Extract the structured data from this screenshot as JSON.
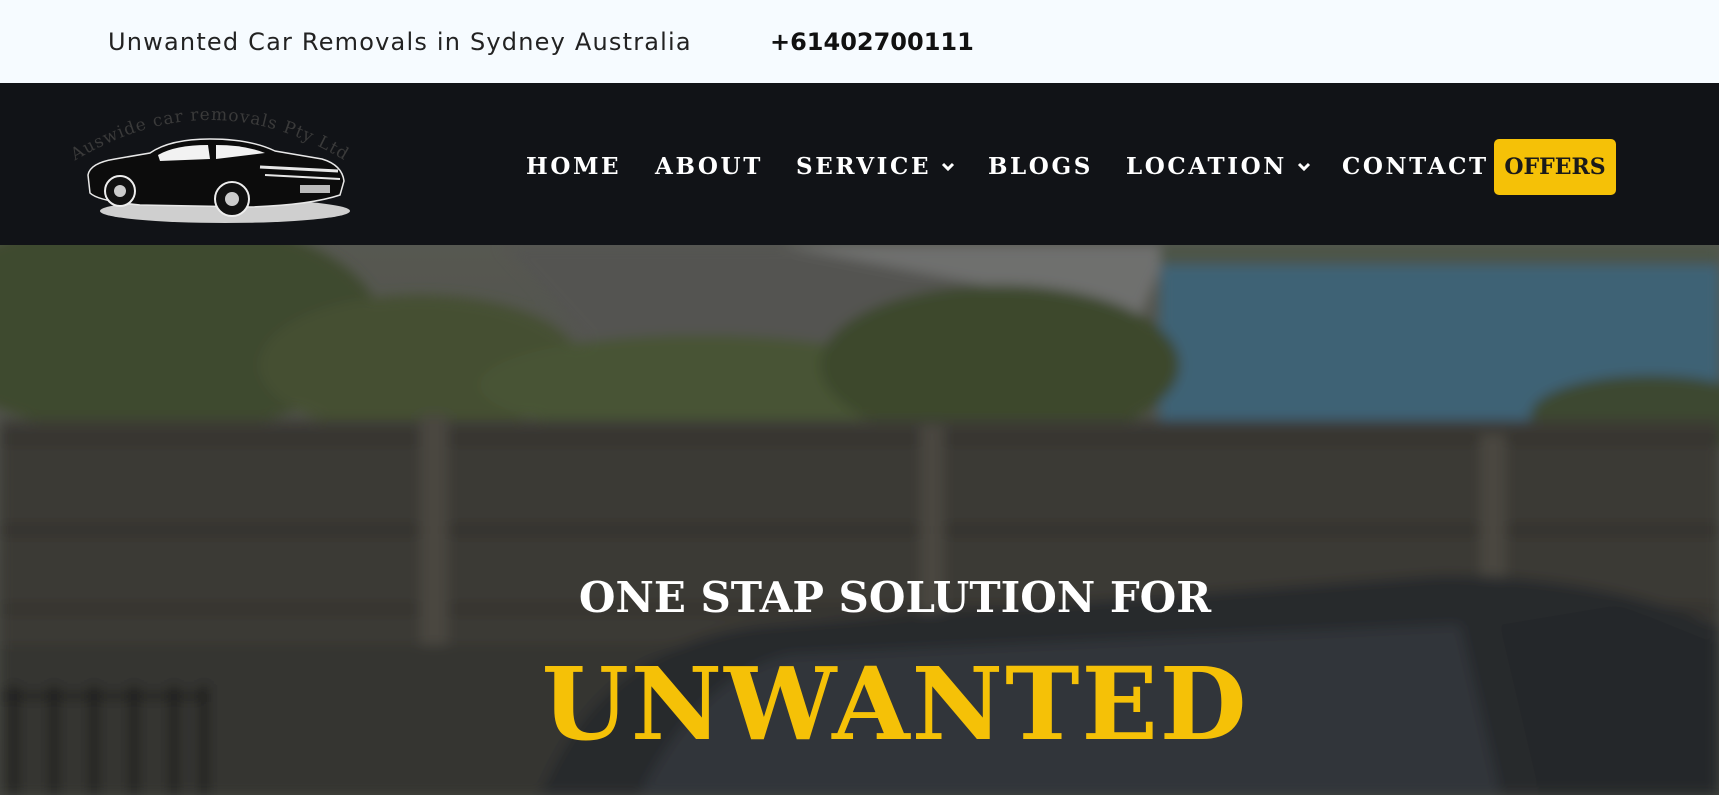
{
  "topbar": {
    "tagline": "Unwanted Car Removals in Sydney Australia",
    "phone": "+61402700111"
  },
  "logo": {
    "text": "Auswide car removals Pty Ltd",
    "icon": "classic-car-icon"
  },
  "nav": {
    "items": [
      {
        "label": "HOME",
        "has_dropdown": false
      },
      {
        "label": "ABOUT",
        "has_dropdown": false
      },
      {
        "label": "SERVICE",
        "has_dropdown": true
      },
      {
        "label": "BLOGS",
        "has_dropdown": false
      },
      {
        "label": "LOCATION",
        "has_dropdown": true
      },
      {
        "label": "CONTACT",
        "has_dropdown": false
      }
    ],
    "offers_label": "OFFERS"
  },
  "hero": {
    "subtitle": "ONE STAP SOLUTION FOR",
    "title": "UNWANTED"
  },
  "colors": {
    "accent": "#f5c107",
    "nav_bg": "#111317",
    "topbar_bg": "#f6fbff"
  }
}
